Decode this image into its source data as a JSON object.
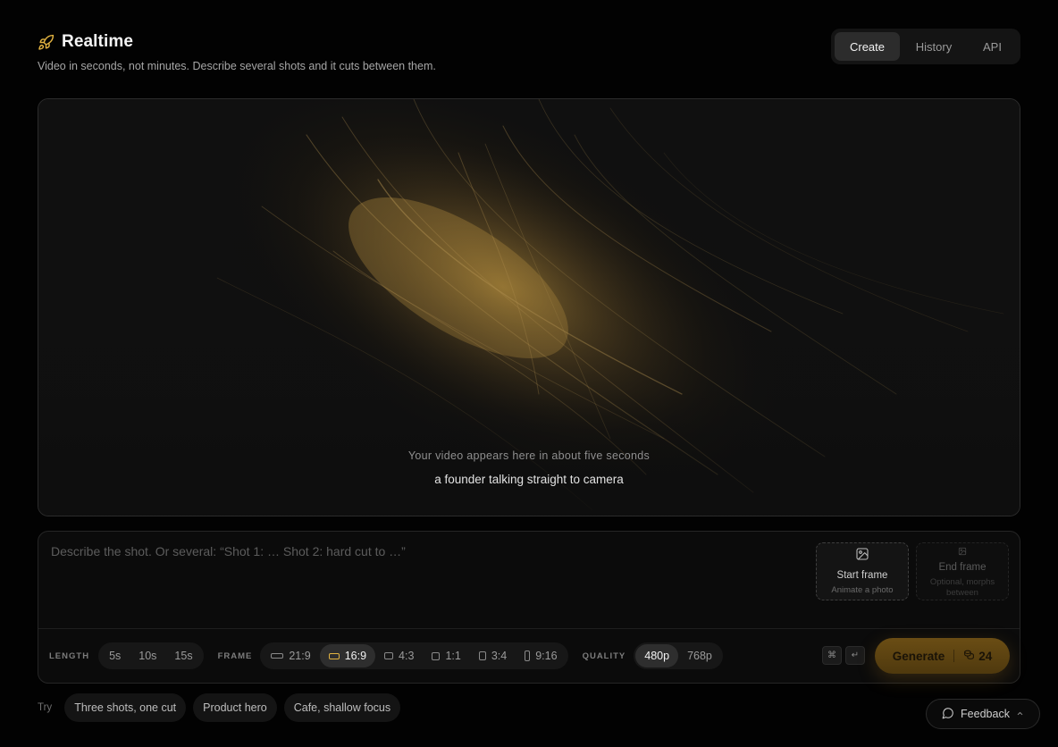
{
  "header": {
    "title": "Realtime",
    "subtitle": "Video in seconds, not minutes. Describe several shots and it cuts between them.",
    "icon": "rocket-icon",
    "accent": "#e2b341"
  },
  "tabs": [
    {
      "label": "Create",
      "active": true
    },
    {
      "label": "History",
      "active": false
    },
    {
      "label": "API",
      "active": false
    }
  ],
  "preview": {
    "hint": "Your video appears here in about five seconds",
    "prompt": "a founder talking straight to camera"
  },
  "composer": {
    "placeholder": "Describe the shot. Or several: “Shot 1: … Shot 2: hard cut to …”",
    "start_frame": {
      "label": "Start frame",
      "sub": "Animate a photo",
      "icon": "image-icon"
    },
    "end_frame": {
      "label": "End frame",
      "sub": "Optional, morphs between",
      "icon": "image-icon"
    }
  },
  "controls": {
    "length": {
      "label": "LENGTH",
      "options": [
        "5s",
        "10s",
        "15s"
      ],
      "selected": null
    },
    "frame": {
      "label": "FRAME",
      "options": [
        "21:9",
        "16:9",
        "4:3",
        "1:1",
        "3:4",
        "9:16"
      ],
      "selected": "16:9"
    },
    "quality": {
      "label": "QUALITY",
      "options": [
        "480p",
        "768p"
      ],
      "selected": "480p"
    }
  },
  "shortcut": {
    "cmd": "⌘",
    "enter": "↵"
  },
  "generate": {
    "label": "Generate",
    "credits": "24",
    "icon": "coins-icon"
  },
  "try": {
    "label": "Try",
    "chips": [
      "Three shots, one cut",
      "Product hero",
      "Cafe, shallow focus"
    ]
  },
  "feedback": {
    "label": "Feedback",
    "icon": "chat-bubble-icon"
  }
}
